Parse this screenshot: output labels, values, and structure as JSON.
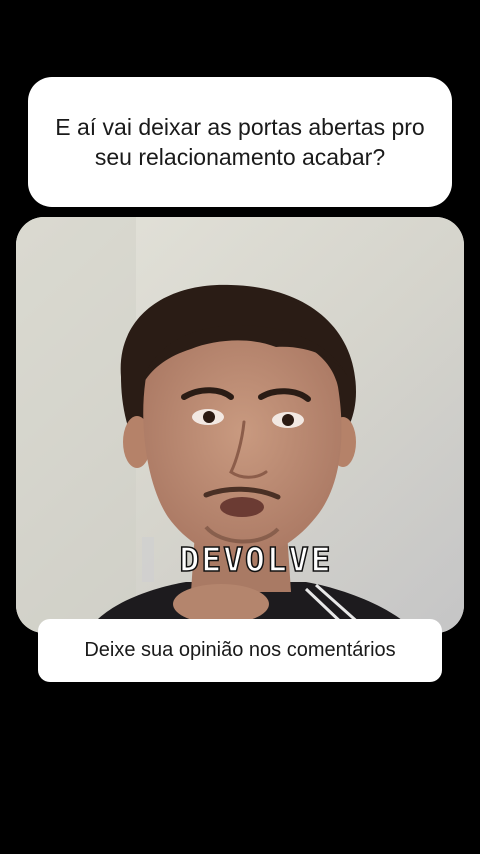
{
  "question_card": {
    "text": "E aí vai deixar as portas abertas pro seu relacionamento acabar?"
  },
  "video": {
    "caption": "DEVOLVE",
    "content_icon": "person-speaking-video"
  },
  "cta_card": {
    "text": "Deixe sua opinião nos comentários"
  },
  "colors": {
    "background": "#000000",
    "card": "#ffffff",
    "text": "#1a1a1a",
    "video_wall": "#d8d7cf",
    "caption": "#ffffff"
  }
}
